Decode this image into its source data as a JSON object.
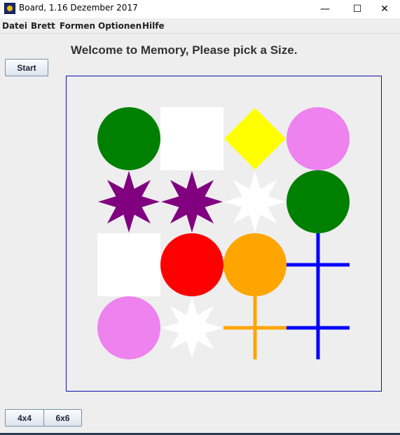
{
  "window": {
    "title": "Board, 1.16 Dezember 2017",
    "minimize_glyph": "—",
    "maximize_glyph": "☐",
    "close_glyph": "✕"
  },
  "menu": [
    "Datei",
    "Brett",
    "Formen",
    "Optionen",
    "Hilfe"
  ],
  "heading": "Welcome to Memory, Please pick a Size.",
  "start_button": "Start",
  "size_buttons": [
    "4x4",
    "6x6"
  ],
  "board": {
    "rows": 4,
    "cols": 4,
    "tiles": [
      {
        "shape": "circle",
        "color": "#008000"
      },
      {
        "shape": "square",
        "color": "#ffffff"
      },
      {
        "shape": "diamond",
        "color": "#ffff00"
      },
      {
        "shape": "circle",
        "color": "#ee82ee"
      },
      {
        "shape": "star",
        "color": "#800080"
      },
      {
        "shape": "star",
        "color": "#800080"
      },
      {
        "shape": "star",
        "color": "#ffffff"
      },
      {
        "shape": "circle",
        "color": "#008000"
      },
      {
        "shape": "square",
        "color": "#ffffff"
      },
      {
        "shape": "circle",
        "color": "#ff0000"
      },
      {
        "shape": "circle",
        "color": "#ffa500"
      },
      {
        "shape": "cross",
        "color": "#0000ff"
      },
      {
        "shape": "circle",
        "color": "#ee82ee"
      },
      {
        "shape": "star",
        "color": "#ffffff"
      },
      {
        "shape": "cross",
        "color": "#ffa500"
      },
      {
        "shape": "cross",
        "color": "#0000ff"
      }
    ]
  }
}
